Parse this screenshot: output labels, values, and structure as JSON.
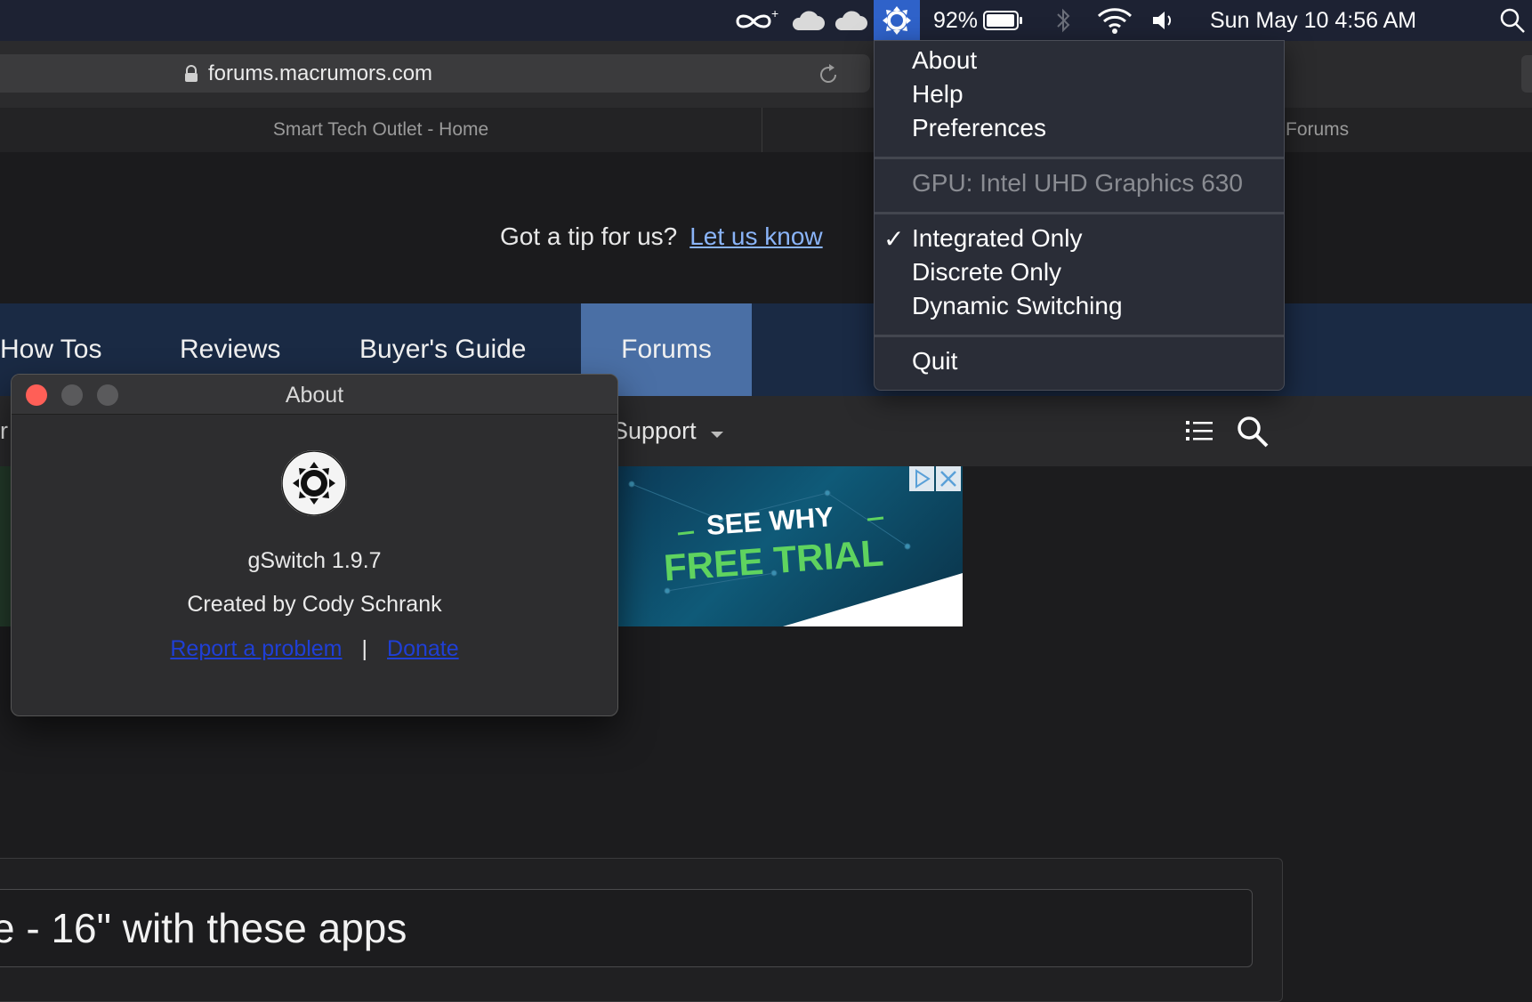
{
  "menubar": {
    "battery": "92%",
    "clock": "Sun May 10  4:56 AM"
  },
  "browser": {
    "url": "forums.macrumors.com",
    "tabs": [
      {
        "label": "Smart Tech Outlet - Home"
      },
      {
        "label": "Forums"
      }
    ]
  },
  "page": {
    "tip_text": "Got a tip for us?",
    "tip_link": "Let us know",
    "nav": [
      "How Tos",
      "Reviews",
      "Buyer's Guide",
      "Forums"
    ],
    "subnav_support": "Support",
    "subnav_left_fragment": "r",
    "ad_line1": "SEE WHY",
    "ad_line2": "FREE TRIAL",
    "title_fragment": "e - 16\" with these apps"
  },
  "about_window": {
    "title": "About",
    "app_name": "gSwitch 1.9.7",
    "author": "Created by Cody Schrank",
    "report_link": "Report a problem",
    "separator": "|",
    "donate_link": "Donate"
  },
  "menu": {
    "about": "About",
    "help": "Help",
    "preferences": "Preferences",
    "gpu": "GPU: Intel UHD Graphics 630",
    "checkmark": "✓",
    "integrated": "Integrated Only",
    "discrete": "Discrete Only",
    "dynamic": "Dynamic Switching",
    "quit": "Quit"
  },
  "colors": {
    "menubar_bg": "#1d2233",
    "menu_highlight": "#2f62c9",
    "nav_active": "#4a6fa5",
    "close_red": "#ff5f57"
  }
}
